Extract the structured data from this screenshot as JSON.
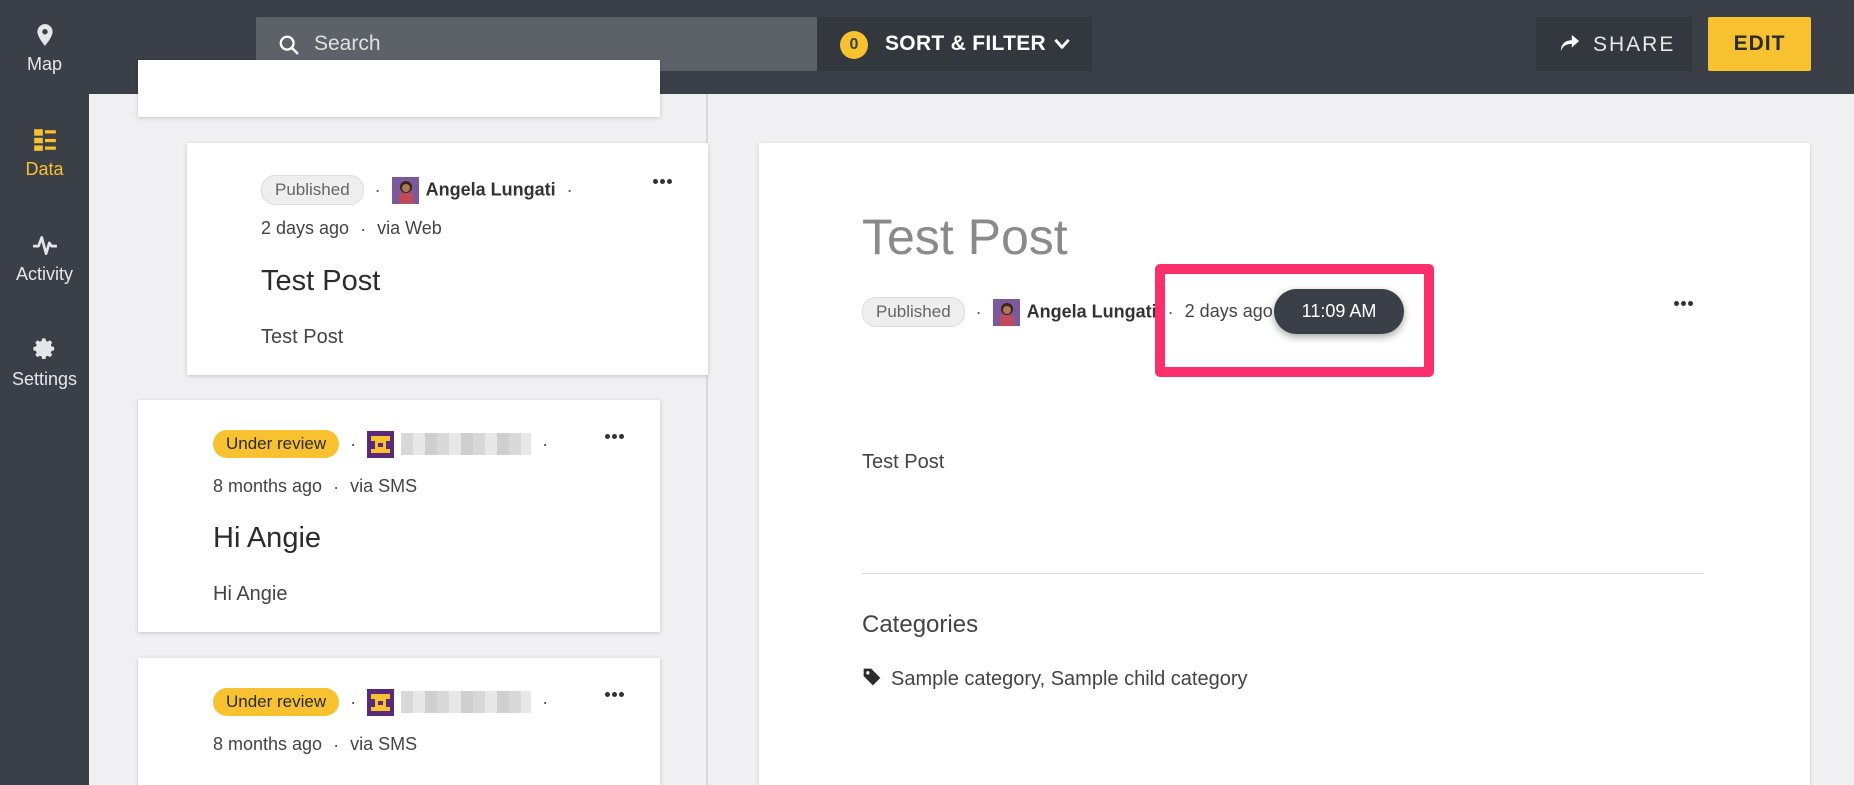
{
  "sidebar": {
    "items": [
      {
        "label": "Map",
        "icon": "map-pin-icon"
      },
      {
        "label": "Data",
        "icon": "data-list-icon"
      },
      {
        "label": "Activity",
        "icon": "activity-pulse-icon"
      },
      {
        "label": "Settings",
        "icon": "gear-icon"
      }
    ],
    "active": "Data"
  },
  "header": {
    "search_placeholder": "Search",
    "filter_count": "0",
    "sort_filter_label": "SORT & FILTER",
    "share_label": "SHARE",
    "edit_label": "EDIT"
  },
  "posts": [
    {
      "status": "Published",
      "author": "Angela Lungati",
      "time": "2 days ago",
      "source": "via Web",
      "title": "Test Post",
      "body": "Test Post"
    },
    {
      "status": "Under review",
      "author": "",
      "time": "8 months ago",
      "source": "via SMS",
      "title": "Hi Angie",
      "body": "Hi Angie"
    },
    {
      "status": "Under review",
      "author": "",
      "time": "8 months ago",
      "source": "via SMS"
    }
  ],
  "detail": {
    "title": "Test Post",
    "status": "Published",
    "author": "Angela Lungati",
    "time": "2 days ago",
    "tooltip_time": "11:09 AM",
    "body": "Test Post",
    "categories_heading": "Categories",
    "categories": "Sample category, Sample child category"
  },
  "colors": {
    "accent": "#f7c12f",
    "chrome": "#3b4048",
    "highlight": "#fc2f6d"
  }
}
